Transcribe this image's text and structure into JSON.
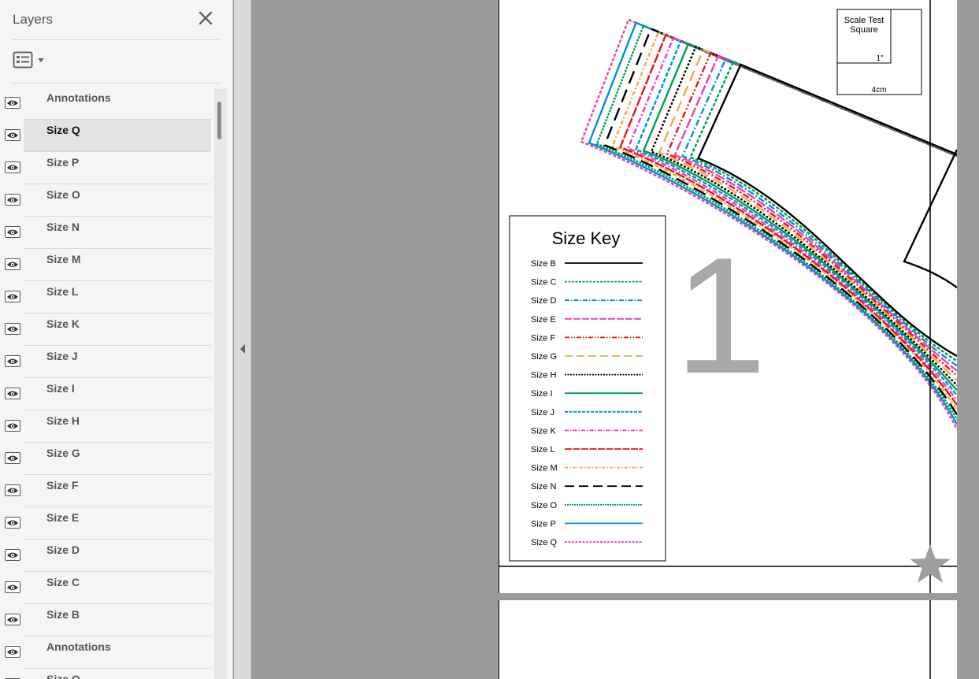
{
  "panel": {
    "title": "Layers",
    "close_icon": "close-icon",
    "options_icon": "layer-options-icon",
    "layers": [
      {
        "label": "Annotations",
        "visible": true,
        "selected": false
      },
      {
        "label": "Size Q",
        "visible": true,
        "selected": true
      },
      {
        "label": "Size P",
        "visible": true,
        "selected": false
      },
      {
        "label": "Size O",
        "visible": true,
        "selected": false
      },
      {
        "label": "Size N",
        "visible": true,
        "selected": false
      },
      {
        "label": "Size M",
        "visible": true,
        "selected": false
      },
      {
        "label": "Size L",
        "visible": true,
        "selected": false
      },
      {
        "label": "Size K",
        "visible": true,
        "selected": false
      },
      {
        "label": "Size J",
        "visible": true,
        "selected": false
      },
      {
        "label": "Size I",
        "visible": true,
        "selected": false
      },
      {
        "label": "Size H",
        "visible": true,
        "selected": false
      },
      {
        "label": "Size G",
        "visible": true,
        "selected": false
      },
      {
        "label": "Size F",
        "visible": true,
        "selected": false
      },
      {
        "label": "Size E",
        "visible": true,
        "selected": false
      },
      {
        "label": "Size D",
        "visible": true,
        "selected": false
      },
      {
        "label": "Size C",
        "visible": true,
        "selected": false
      },
      {
        "label": "Size B",
        "visible": true,
        "selected": false
      },
      {
        "label": "Annotations",
        "visible": true,
        "selected": false
      },
      {
        "label": "Size Q",
        "visible": true,
        "selected": false
      }
    ]
  },
  "document": {
    "scale_square": {
      "title": "Scale Test Square",
      "inch_label": "1\"",
      "cm_label": "4cm"
    },
    "page_number": "1",
    "size_key": {
      "title": "Size Key",
      "entries": [
        {
          "label": "Size B",
          "color": "#000000",
          "dash": ""
        },
        {
          "label": "Size C",
          "color": "#009e4f",
          "dash": "3 1.5"
        },
        {
          "label": "Size D",
          "color": "#0091d5",
          "dash": "6 2 1.5 2"
        },
        {
          "label": "Size E",
          "color": "#ef3fb3",
          "dash": "9 2"
        },
        {
          "label": "Size F",
          "color": "#e8141c",
          "dash": "6 2 1.5 2 1.5 2"
        },
        {
          "label": "Size G",
          "color": "#f5a64a",
          "dash": "10 5"
        },
        {
          "label": "Size H",
          "color": "#000000",
          "dash": "2 1.5"
        },
        {
          "label": "Size I",
          "color": "#009e4f",
          "dash": ""
        },
        {
          "label": "Size J",
          "color": "#0091d5",
          "dash": "4 1.5"
        },
        {
          "label": "Size K",
          "color": "#ef3fb3",
          "dash": "5 2 1.5 2"
        },
        {
          "label": "Size L",
          "color": "#e8141c",
          "dash": "9 1.5"
        },
        {
          "label": "Size M",
          "color": "#f5a64a",
          "dash": "4 2 1.5 2"
        },
        {
          "label": "Size N",
          "color": "#000000",
          "dash": "12 6"
        },
        {
          "label": "Size O",
          "color": "#009e4f",
          "dash": "2 1"
        },
        {
          "label": "Size P",
          "color": "#0091d5",
          "dash": ""
        },
        {
          "label": "Size Q",
          "color": "#ef3fb3",
          "dash": "3 1.5"
        }
      ]
    },
    "star_icon": "star-icon"
  }
}
